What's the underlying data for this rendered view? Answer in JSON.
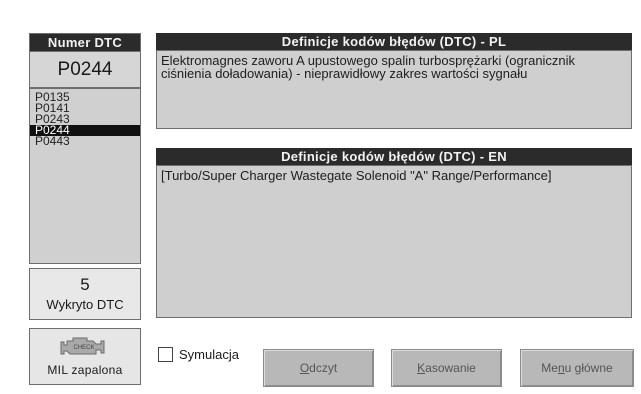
{
  "code_panel": {
    "header": "Numer DTC",
    "value": "P0244"
  },
  "dtc_list": {
    "items": [
      "P0135",
      "P0141",
      "P0243",
      "P0244",
      "P0443"
    ],
    "selected": "P0244"
  },
  "count": {
    "number": "5",
    "label": "Wykryto DTC"
  },
  "mil": {
    "icon": "engine-check-icon",
    "label": "MIL zapalona"
  },
  "pl_definition": {
    "header": "Definicje kodów błędów (DTC) - PL",
    "text": "Elektromagnes zaworu A upustowego spalin turbosprężarki (ogranicznik ciśnienia doładowania) - nieprawidłowy zakres wartości sygnału"
  },
  "en_definition": {
    "header": "Definicje kodów błędów (DTC) - EN",
    "text": "[Turbo/Super Charger Wastegate Solenoid \"A\" Range/Performance]"
  },
  "simulation": {
    "label": "Symulacja",
    "checked": false
  },
  "buttons": {
    "read": {
      "hotkey": "O",
      "rest": "dczyt"
    },
    "clear": {
      "hotkey": "K",
      "rest": "asowanie"
    },
    "menu": {
      "before": "Me",
      "hotkey": "n",
      "after": "u główne"
    }
  }
}
